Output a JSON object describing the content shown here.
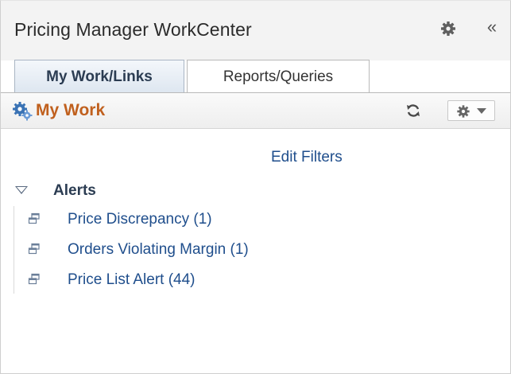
{
  "header": {
    "title": "Pricing Manager WorkCenter",
    "collapse_glyph": "«",
    "icons": [
      "gear-icon",
      "collapse-icon"
    ]
  },
  "tabs": [
    {
      "label": "My Work/Links",
      "active": true
    },
    {
      "label": "Reports/Queries",
      "active": false
    }
  ],
  "my_work": {
    "title": "My Work",
    "icons": [
      "gears-icon",
      "refresh-icon",
      "actions-gear-icon",
      "caret-down-icon"
    ]
  },
  "filters": {
    "edit_label": "Edit Filters"
  },
  "alerts": {
    "label": "Alerts",
    "items": [
      {
        "label": "Price Discrepancy (1)"
      },
      {
        "label": "Orders Violating Margin (1)"
      },
      {
        "label": "Price List Alert (44)"
      }
    ]
  },
  "colors": {
    "accent_orange": "#c0601e",
    "link_blue": "#1f4e8c",
    "header_bg": "#f3f3f3"
  }
}
